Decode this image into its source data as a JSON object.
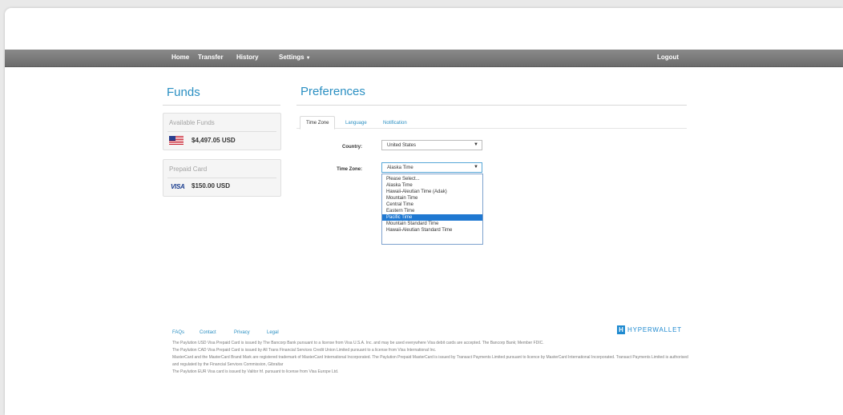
{
  "nav": {
    "home": "Home",
    "transfer": "Transfer",
    "history": "History",
    "settings": "Settings",
    "logout": "Logout"
  },
  "funds": {
    "title": "Funds",
    "available_title": "Available Funds",
    "available_amount": "$4,497.05 USD",
    "prepaid_title": "Prepaid Card",
    "prepaid_amount": "$150.00 USD",
    "visa_text": "VISA"
  },
  "preferences": {
    "title": "Preferences",
    "tabs": [
      "Time Zone",
      "Language",
      "Notification"
    ],
    "country_label": "Country:",
    "country_value": "United States",
    "timezone_label": "Time Zone:",
    "timezone_value": "Alaska Time",
    "timezone_options": [
      "Please Select...",
      "Alaska Time",
      "Hawaii-Aleutian Time (Adak)",
      "Mountain Time",
      "Central Time",
      "Eastern Time",
      "Pacific Time",
      "Mountain Standard Time",
      "Hawaii-Aleutian Standard Time"
    ],
    "highlighted_option": "Pacific Time"
  },
  "footer": {
    "links": [
      "FAQs",
      "Contact",
      "Privacy",
      "Legal"
    ],
    "brand": "HYPERWALLET",
    "brand_mark": "H",
    "lines": [
      "The Paylution USD Visa Prepaid Card is issued by The Bancorp Bank pursuant to a license from Visa U.S.A. Inc. and may be used everywhere Visa debit cards are accepted. The Bancorp Bank; Member FDIC.",
      "The Paylution CAD Visa Prepaid Card is issued by All Trans Financial Services Credit Union Limited pursuant to a license from Visa International Inc.",
      "MasterCard and the MasterCard Brand Mark are registered trademark of MasterCard International Incorporated. The Paylution Prepaid MasterCard is issued by Transact Payments Limited pursuant to licence by MasterCard International Incorporated. Transact Payments Limited is authorised and regulated by the Financial Services Commission, Gibraltar",
      "The Paylution EUR Visa card is issued by Valitor hf. pursuant to license from Visa Europe Ltd."
    ]
  },
  "colors": {
    "accent": "#2a8fc2",
    "navbar": "#7a7a7a",
    "highlight": "#1f78d1"
  }
}
